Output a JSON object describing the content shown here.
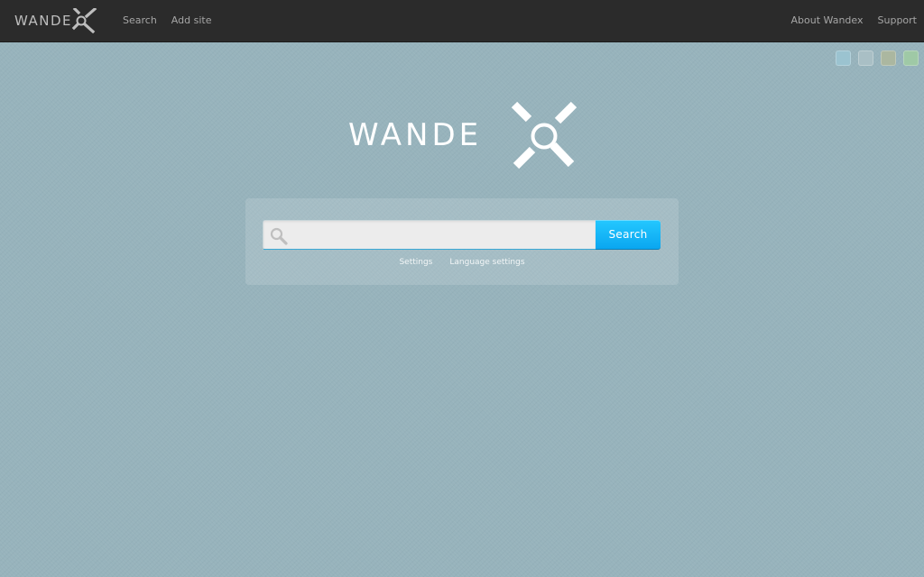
{
  "topbar": {
    "logo_text": "WANDE",
    "nav_left": [
      {
        "label": "Search"
      },
      {
        "label": "Add site"
      }
    ],
    "nav_right": [
      {
        "label": "About Wandex"
      },
      {
        "label": "Support"
      }
    ]
  },
  "themes": {
    "swatches": [
      {
        "name": "blue",
        "color": "#9bc3d0"
      },
      {
        "name": "grey",
        "color": "#a9bfc5"
      },
      {
        "name": "olive",
        "color": "#abb7a0"
      },
      {
        "name": "green",
        "color": "#9fc9a6"
      }
    ]
  },
  "main_logo": {
    "text": "WANDE"
  },
  "search": {
    "value": "",
    "placeholder": "",
    "button_label": "Search",
    "links": [
      {
        "label": "Settings"
      },
      {
        "label": "Language settings"
      }
    ]
  },
  "colors": {
    "page_background": "#97b3bc",
    "topbar_background": "#2b2b2b",
    "search_button": "#12b4f6"
  },
  "icons": [
    "wandex-x-logo-icon",
    "magnifier-icon"
  ]
}
